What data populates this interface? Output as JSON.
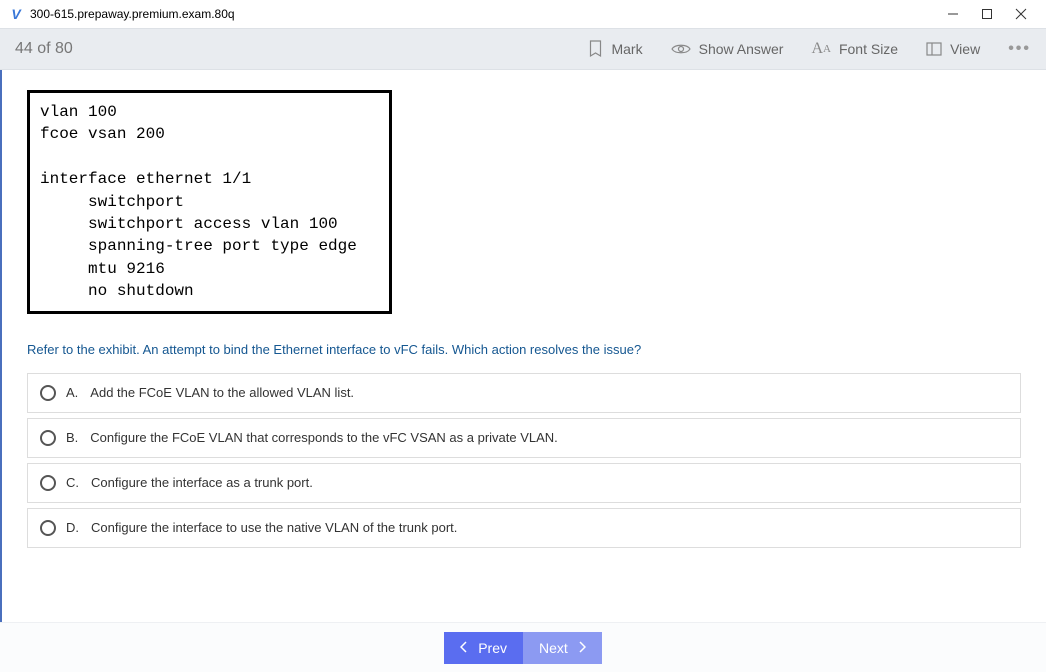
{
  "window": {
    "title": "300-615.prepaway.premium.exam.80q",
    "icon_glyph": "V"
  },
  "toolbar": {
    "progress": "44 of 80",
    "mark_label": "Mark",
    "show_answer_label": "Show Answer",
    "font_size_label": "Font Size",
    "view_label": "View"
  },
  "exhibit": {
    "text": "vlan 100\nfcoe vsan 200\n\ninterface ethernet 1/1\n     switchport\n     switchport access vlan 100\n     spanning-tree port type edge\n     mtu 9216\n     no shutdown"
  },
  "question": {
    "text": "Refer to the exhibit. An attempt to bind the Ethernet interface to vFC fails. Which action resolves the issue?"
  },
  "options": [
    {
      "letter": "A.",
      "text": "Add the FCoE VLAN to the allowed VLAN list."
    },
    {
      "letter": "B.",
      "text": "Configure the FCoE VLAN that corresponds to the vFC VSAN as a private VLAN."
    },
    {
      "letter": "C.",
      "text": "Configure the interface as a trunk port."
    },
    {
      "letter": "D.",
      "text": "Configure the interface to use the native VLAN of the trunk port."
    }
  ],
  "footer": {
    "prev_label": "Prev",
    "next_label": "Next"
  }
}
